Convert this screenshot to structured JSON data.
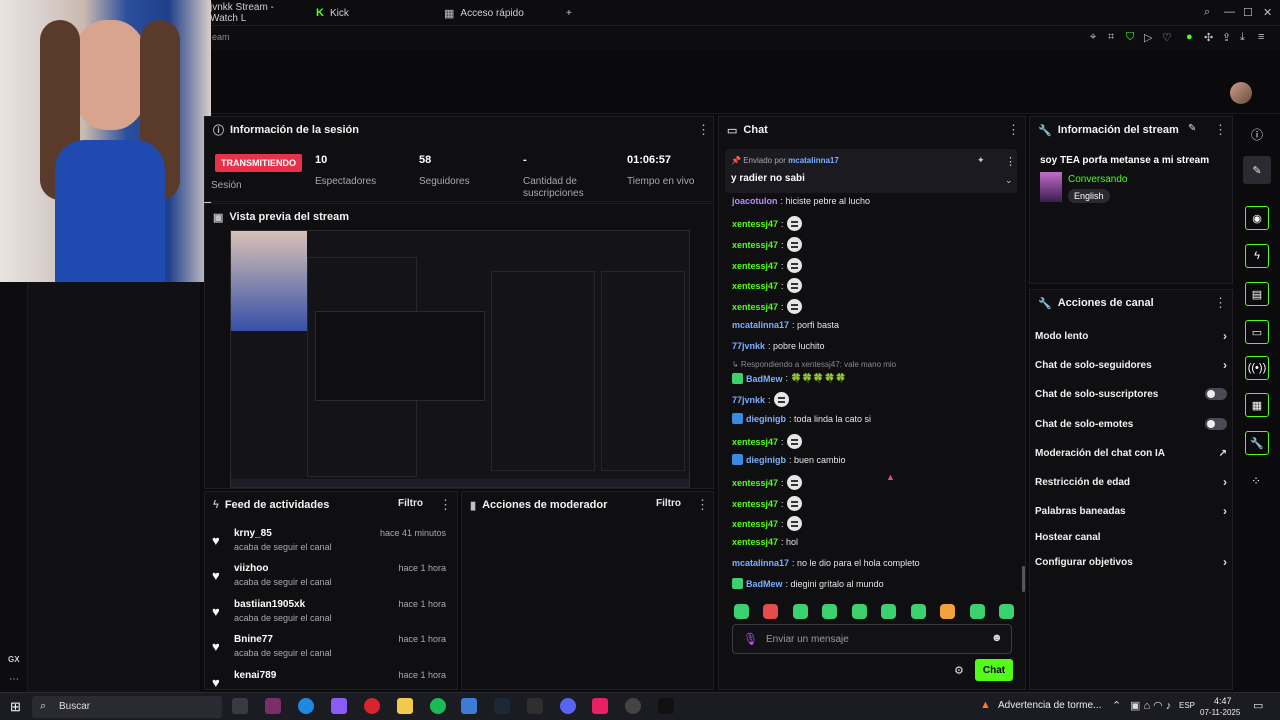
{
  "browser": {
    "tabs": [
      {
        "label": "jvnkk Stream - Watch L"
      },
      {
        "label": "Kick"
      },
      {
        "label": "Acceso rápido"
      }
    ],
    "new_tab": "+",
    "address_fragment": "eam"
  },
  "session": {
    "title": "Información de la sesión",
    "live_badge": "TRANSMITIENDO",
    "session_label": "Sesión",
    "stats": [
      {
        "value": "10",
        "label": "Espectadores"
      },
      {
        "value": "58",
        "label": "Seguidores"
      },
      {
        "value": "-",
        "label": "Cantidad de suscripciones"
      },
      {
        "value": "01:06:57",
        "label": "Tiempo en vivo"
      }
    ]
  },
  "preview": {
    "title": "Vista previa del stream"
  },
  "feed": {
    "title": "Feed de actividades",
    "filter": "Filtro",
    "items": [
      {
        "user": "krny_85",
        "sub": "acaba de seguir el canal",
        "time": "hace 41 minutos"
      },
      {
        "user": "viizhoo",
        "sub": "acaba de seguir el canal",
        "time": "hace 1 hora"
      },
      {
        "user": "bastiian1905xk",
        "sub": "acaba de seguir el canal",
        "time": "hace 1 hora"
      },
      {
        "user": "Bnine77",
        "sub": "acaba de seguir el canal",
        "time": "hace 1 hora"
      },
      {
        "user": "kenai789",
        "sub": "",
        "time": "hace 1 hora"
      }
    ]
  },
  "moderator": {
    "title": "Acciones de moderador",
    "filter": "Filtro"
  },
  "chat": {
    "title": "Chat",
    "pinned_by_label": "Enviado por",
    "pinned_by_user": "mcatalinna17",
    "pinned_text": "y radier no sabi",
    "messages": [
      {
        "user": "joacotulon",
        "text": ": hiciste pebre al lucho",
        "style": "purple"
      },
      {
        "user": "xentessj47",
        "text": ":",
        "style": "green",
        "emote": true
      },
      {
        "user": "xentessj47",
        "text": ":",
        "style": "green",
        "emote": true
      },
      {
        "user": "xentessj47",
        "text": ":",
        "style": "green",
        "emote": true
      },
      {
        "user": "xentessj47",
        "text": ":",
        "style": "green",
        "emote": true
      },
      {
        "user": "xentessj47",
        "text": ":",
        "style": "green",
        "emote": true
      },
      {
        "user": "mcatalinna17",
        "text": ": porfi basta",
        "style": "blue"
      },
      {
        "user": "77jvnkk",
        "text": ": pobre luchito",
        "style": "blue"
      },
      {
        "user": "",
        "text": "↳ Respondiendo a xentessj47: vale mano mio",
        "style": "reply"
      },
      {
        "user": "BadMew",
        "text": ": 🍀🍀🍀🍀🍀",
        "style": "blue"
      },
      {
        "user": "77jvnkk",
        "text": ":",
        "style": "blue",
        "emote": true
      },
      {
        "user": "dieginigb",
        "text": ": toda linda la cato si",
        "style": "blue"
      },
      {
        "user": "xentessj47",
        "text": ":",
        "style": "green",
        "emote": true
      },
      {
        "user": "dieginigb",
        "text": ": buen cambio",
        "style": "blue"
      },
      {
        "user": "xentessj47",
        "text": ":",
        "style": "green",
        "emote": true
      },
      {
        "user": "xentessj47",
        "text": ":",
        "style": "green",
        "emote": true
      },
      {
        "user": "xentessj47",
        "text": ":",
        "style": "green",
        "emote": true
      },
      {
        "user": "xentessj47",
        "text": ": hol",
        "style": "green"
      },
      {
        "user": "mcatalinna17",
        "text": ": no le dio para el hola completo",
        "style": "blue"
      },
      {
        "user": "BadMew",
        "text": ": diegini grítalo al mundo",
        "style": "blue"
      }
    ],
    "input_placeholder": "Enviar un mensaje",
    "send_label": "Chat"
  },
  "stream_info": {
    "title": "Información del stream",
    "stream_title": "soy TEA porfa metanse a mi stream",
    "category": "Conversando",
    "language": "English"
  },
  "channel_actions": {
    "title": "Acciones de canal",
    "items": [
      {
        "label": "Modo lento",
        "control": "chevron"
      },
      {
        "label": "Chat de solo-seguidores",
        "control": "chevron"
      },
      {
        "label": "Chat de solo-suscriptores",
        "control": "toggle"
      },
      {
        "label": "Chat de solo-emotes",
        "control": "toggle"
      },
      {
        "label": "Moderación del chat con IA",
        "control": "external"
      },
      {
        "label": "Restricción de edad",
        "control": "chevron"
      },
      {
        "label": "Palabras baneadas",
        "control": "chevron"
      },
      {
        "label": "Hostear canal",
        "control": "none"
      },
      {
        "label": "Configurar objetivos",
        "control": "chevron"
      }
    ]
  },
  "sidebar": {
    "gx_label": "GX"
  },
  "taskbar": {
    "search": "Buscar",
    "weather": "Advertencia de torme...",
    "lang": "ESP",
    "time": "4:47",
    "date": "07-11-2025"
  },
  "colors": {
    "accent": "#53fc18",
    "live": "#e8314b"
  }
}
